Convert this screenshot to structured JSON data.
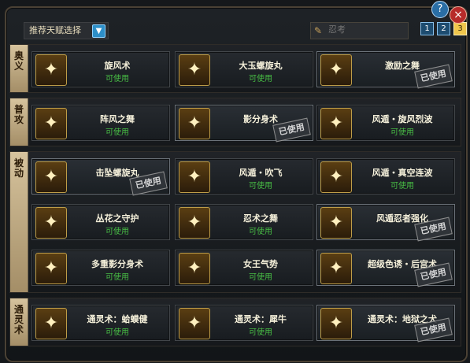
{
  "window": {
    "help_label": "?",
    "close_label": "×"
  },
  "toolbar": {
    "dropdown_label": "推荐天赋选择",
    "search_placeholder": "忍考",
    "pages": [
      "1",
      "2",
      "3"
    ],
    "active_page": "3"
  },
  "sections": [
    {
      "label": "奥义",
      "cards": [
        {
          "name": "旋风术",
          "status": "可使用",
          "used": false,
          "selected": false,
          "icon": "tornado-icon"
        },
        {
          "name": "大玉螺旋丸",
          "status": "可使用",
          "used": false,
          "selected": false,
          "icon": "vortex-icon"
        },
        {
          "name": "激励之舞",
          "status": "",
          "used": true,
          "selected": true,
          "icon": "dancer-icon"
        }
      ]
    },
    {
      "label": "普攻",
      "cards": [
        {
          "name": "阵风之舞",
          "status": "可使用",
          "used": false,
          "selected": false,
          "icon": "wind-swirl-icon"
        },
        {
          "name": "影分身术",
          "status": "",
          "used": true,
          "selected": true,
          "icon": "clones-icon"
        },
        {
          "name": "风遁・旋风烈波",
          "status": "可使用",
          "used": false,
          "selected": false,
          "icon": "slash-icon"
        }
      ]
    },
    {
      "label": "被动",
      "cards": [
        {
          "name": "击坠螺旋丸",
          "status": "",
          "used": true,
          "selected": true,
          "icon": "glowing-orb-icon"
        },
        {
          "name": "风遁・吹飞",
          "status": "可使用",
          "used": false,
          "selected": false,
          "icon": "fan-icon"
        },
        {
          "name": "风遁・真空连波",
          "status": "可使用",
          "used": false,
          "selected": false,
          "icon": "wave-icon"
        },
        {
          "name": "丛花之守护",
          "status": "可使用",
          "used": false,
          "selected": false,
          "icon": "cat-guardian-icon"
        },
        {
          "name": "忍术之舞",
          "status": "可使用",
          "used": false,
          "selected": false,
          "icon": "scroll-icon"
        },
        {
          "name": "风遁忍者强化",
          "status": "",
          "used": true,
          "selected": true,
          "icon": "wind-rune-icon"
        },
        {
          "name": "多重影分身术",
          "status": "可使用",
          "used": false,
          "selected": false,
          "icon": "crowd-clone-icon"
        },
        {
          "name": "女王气势",
          "status": "可使用",
          "used": false,
          "selected": false,
          "icon": "queen-icon"
        },
        {
          "name": "超级色诱・后宫术",
          "status": "",
          "used": true,
          "selected": true,
          "icon": "harem-icon"
        }
      ]
    },
    {
      "label": "通灵术",
      "cards": [
        {
          "name": "通灵术：蛤蟆健",
          "status": "可使用",
          "used": false,
          "selected": false,
          "icon": "toad-icon"
        },
        {
          "name": "通灵术：犀牛",
          "status": "可使用",
          "used": false,
          "selected": false,
          "icon": "rhino-icon"
        },
        {
          "name": "通灵术：地狱之犬",
          "status": "",
          "used": true,
          "selected": true,
          "icon": "hellhound-icon"
        }
      ]
    }
  ],
  "stamp_label": "已使用"
}
